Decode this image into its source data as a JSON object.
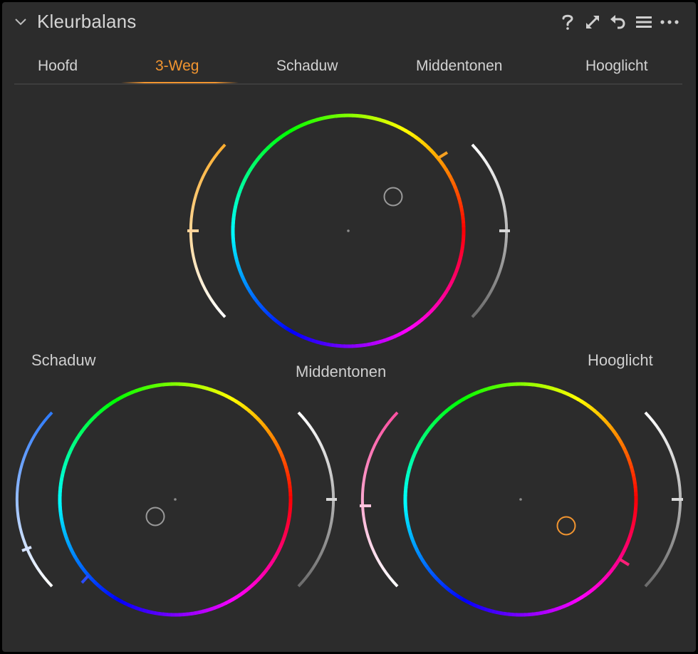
{
  "panel": {
    "title": "Kleurbalans"
  },
  "header_icons": [
    {
      "name": "help-icon",
      "glyph": "?"
    },
    {
      "name": "expand-icon",
      "glyph": "expand"
    },
    {
      "name": "reset-icon",
      "glyph": "undo"
    },
    {
      "name": "presets-icon",
      "glyph": "menu"
    },
    {
      "name": "more-icon",
      "glyph": "more"
    }
  ],
  "tabs": [
    {
      "label": "Hoofd",
      "active": false
    },
    {
      "label": "3-Weg",
      "active": true
    },
    {
      "label": "Schaduw",
      "active": false
    },
    {
      "label": "Middentonen",
      "active": false
    },
    {
      "label": "Hooglicht",
      "active": false
    }
  ],
  "wheel_labels": {
    "shadows": "Schaduw",
    "midtones": "Middentonen",
    "highlights": "Hooglicht"
  },
  "colors": {
    "accent": "#f29530",
    "panel_bg": "#2c2c2c",
    "text": "#d2d2d2"
  }
}
